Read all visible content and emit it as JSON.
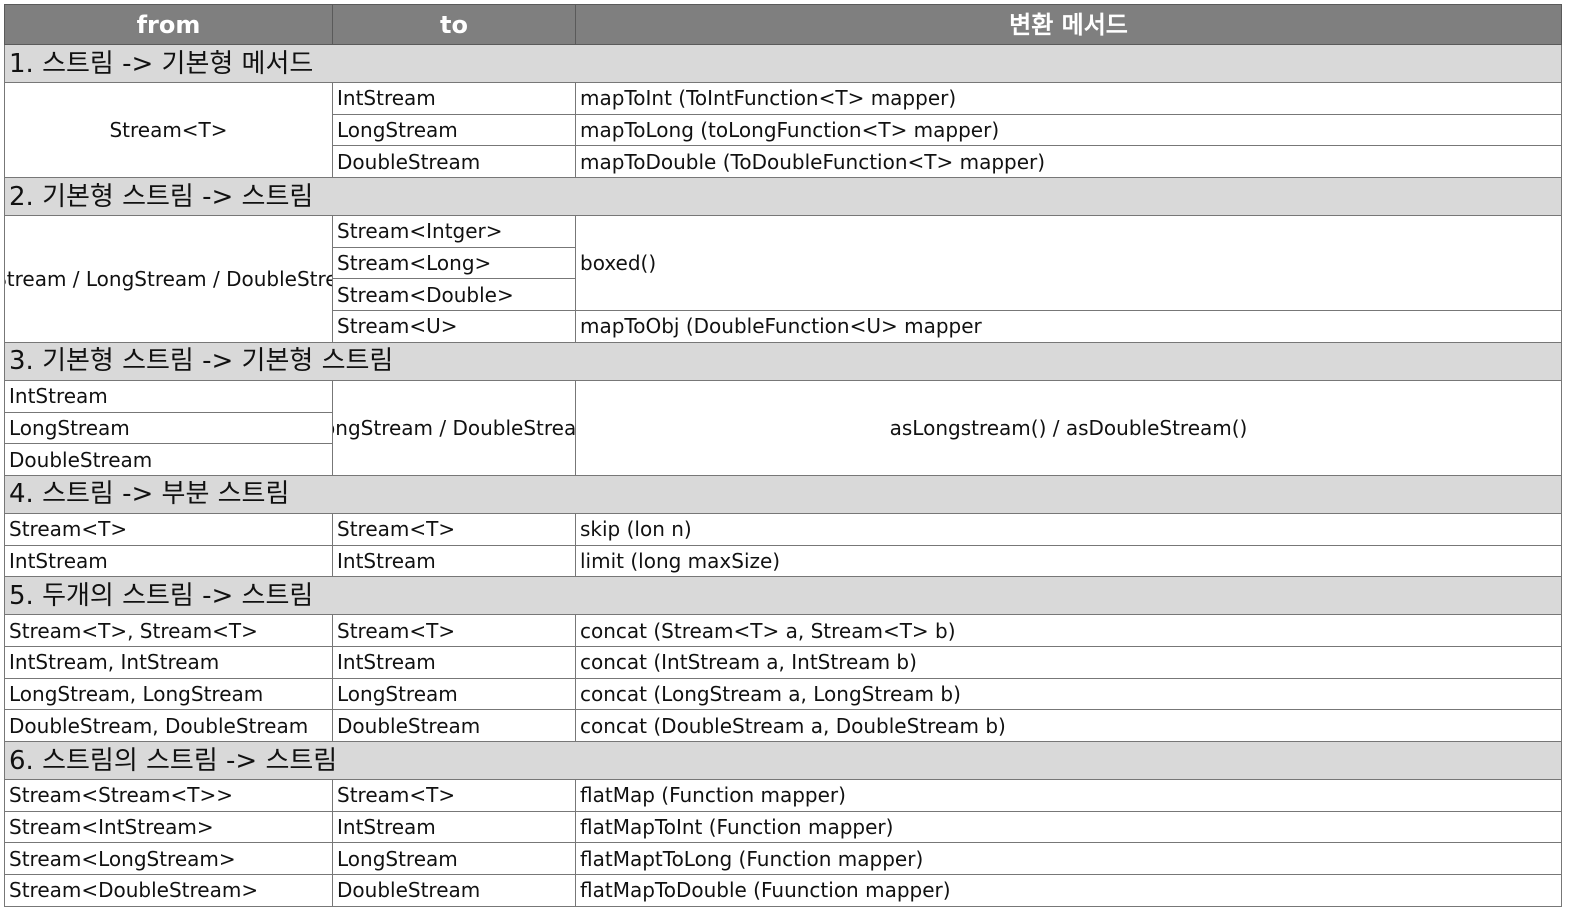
{
  "headers": {
    "from": "from",
    "to": "to",
    "method": "변환 메서드"
  },
  "sections": {
    "s1": {
      "title": "1. 스트림 -> 기본형 메서드",
      "from": "Stream<T>",
      "rows": [
        {
          "to": "IntStream",
          "method": "mapToInt (ToIntFunction<T> mapper)"
        },
        {
          "to": "LongStream",
          "method": "mapToLong (toLongFunction<T> mapper)"
        },
        {
          "to": "DoubleStream",
          "method": "mapToDouble (ToDoubleFunction<T> mapper)"
        }
      ]
    },
    "s2": {
      "title": "2. 기본형 스트림 -> 스트림",
      "from": "IntStream / LongStream / DoubleStream",
      "to": [
        "Stream<Intger>",
        "Stream<Long>",
        "Stream<Double>",
        "Stream<U>"
      ],
      "method_boxed": "boxed()",
      "method_maptoobj": "mapToObj (DoubleFunction<U> mapper"
    },
    "s3": {
      "title": "3. 기본형 스트림 -> 기본형 스트림",
      "from": [
        "IntStream",
        "LongStream",
        "DoubleStream"
      ],
      "to": "LongStream / DoubleStream",
      "method": "asLongstream() / asDoubleStream()"
    },
    "s4": {
      "title": "4. 스트림 -> 부분 스트림",
      "rows": [
        {
          "from": "Stream<T>",
          "to": "Stream<T>",
          "method": "skip (lon n)"
        },
        {
          "from": "IntStream",
          "to": "IntStream",
          "method": "limit (long maxSize)"
        }
      ]
    },
    "s5": {
      "title": "5. 두개의 스트림 -> 스트림",
      "rows": [
        {
          "from": "Stream<T>, Stream<T>",
          "to": "Stream<T>",
          "method": "concat (Stream<T> a, Stream<T> b)"
        },
        {
          "from": "IntStream, IntStream",
          "to": "IntStream",
          "method": "concat (IntStream a, IntStream b)"
        },
        {
          "from": "LongStream, LongStream",
          "to": "LongStream",
          "method": "concat (LongStream a, LongStream b)"
        },
        {
          "from": "DoubleStream, DoubleStream",
          "to": "DoubleStream",
          "method": "concat (DoubleStream a, DoubleStream b)"
        }
      ]
    },
    "s6": {
      "title": "6. 스트림의 스트림 -> 스트림",
      "rows": [
        {
          "from": "Stream<Stream<T>>",
          "to": "Stream<T>",
          "method": "flatMap (Function mapper)"
        },
        {
          "from": "Stream<IntStream>",
          "to": "IntStream",
          "method": "flatMapToInt (Function mapper)"
        },
        {
          "from": "Stream<LongStream>",
          "to": "LongStream",
          "method": "flatMaptToLong (Function mapper)"
        },
        {
          "from": "Stream<DoubleStream>",
          "to": "DoubleStream",
          "method": "flatMapToDouble (Fuunction mapper)"
        }
      ]
    }
  }
}
